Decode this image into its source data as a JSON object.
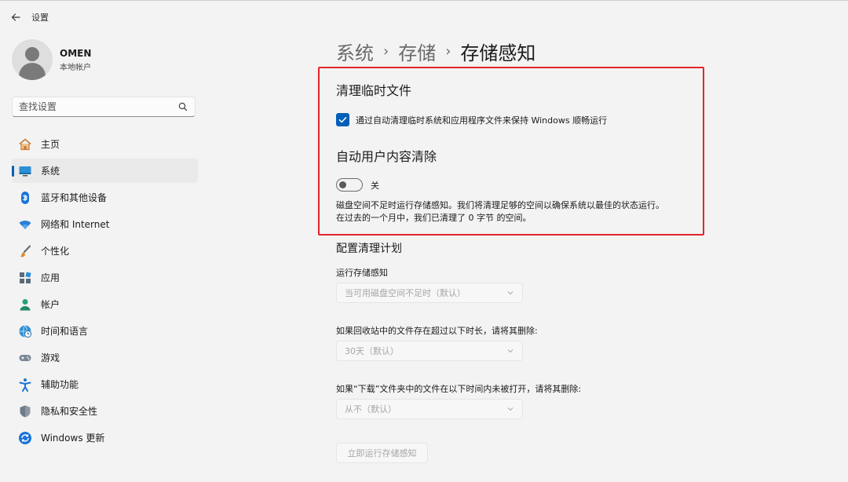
{
  "app": {
    "title": "设置"
  },
  "profile": {
    "name": "OMEN",
    "account_type": "本地帐户"
  },
  "search": {
    "placeholder": "查找设置"
  },
  "nav": [
    {
      "label": "主页",
      "icon": "home-icon"
    },
    {
      "label": "系统",
      "icon": "system-icon",
      "active": true
    },
    {
      "label": "蓝牙和其他设备",
      "icon": "bluetooth-icon"
    },
    {
      "label": "网络和 Internet",
      "icon": "wifi-icon"
    },
    {
      "label": "个性化",
      "icon": "brush-icon"
    },
    {
      "label": "应用",
      "icon": "apps-icon"
    },
    {
      "label": "帐户",
      "icon": "account-icon"
    },
    {
      "label": "时间和语言",
      "icon": "globe-clock-icon"
    },
    {
      "label": "游戏",
      "icon": "gamepad-icon"
    },
    {
      "label": "辅助功能",
      "icon": "accessibility-icon"
    },
    {
      "label": "隐私和安全性",
      "icon": "shield-icon"
    },
    {
      "label": "Windows 更新",
      "icon": "update-icon"
    }
  ],
  "breadcrumb": {
    "level1": "系统",
    "level2": "存储",
    "current": "存储感知",
    "separator": "›"
  },
  "cleanup_temp": {
    "title": "清理临时文件",
    "checkbox_label": "通过自动清理临时系统和应用程序文件来保持 Windows 顺畅运行",
    "checked": true
  },
  "auto_cleanup": {
    "title": "自动用户内容清除",
    "toggle_label": "关",
    "toggle_on": false,
    "description": "磁盘空间不足时运行存储感知。我们将清理足够的空间以确保系统以最佳的状态运行。 在过去的一个月中，我们已清理了 0 字节 的空间。"
  },
  "schedule": {
    "title": "配置清理计划",
    "run_label": "运行存储感知",
    "run_value": "当可用磁盘空间不足时（默认）",
    "recycle_label": "如果回收站中的文件存在超过以下时长，请将其删除:",
    "recycle_value": "30天（默认）",
    "downloads_label": "如果“下载”文件夹中的文件在以下时间内未被打开，请将其删除:",
    "downloads_value": "从不（默认）",
    "run_now_button": "立即运行存储感知"
  },
  "colors": {
    "accent": "#005fb8",
    "highlight_box": "#e2242a",
    "disabled_text": "#a6a6a6"
  }
}
